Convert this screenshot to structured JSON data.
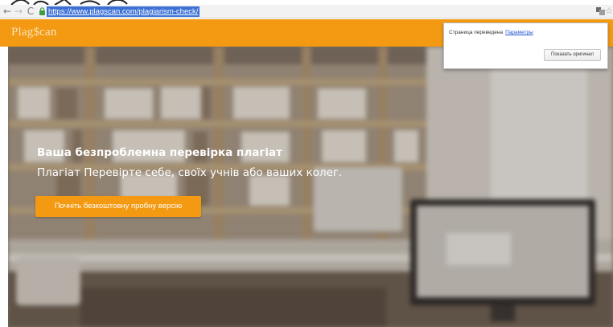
{
  "browser": {
    "url": "https://www.plagscan.com/plagiarism-check/",
    "back_glyph": "←",
    "forward_glyph": "→",
    "reload_glyph": "C",
    "star_glyph": "☆",
    "icons": [
      "back-arrow-icon",
      "forward-arrow-icon",
      "reload-icon",
      "lock-icon",
      "translate-icon",
      "star-icon"
    ]
  },
  "header": {
    "logo_text": "Plag$can",
    "bg_color": "#f39a12"
  },
  "hero": {
    "title": "Ваша безпроблемна перевірка плагіат",
    "subtitle": "Плагіат Перевірте себе, своїх учнів або ваших колег.",
    "cta_label": "Почніть безкоштовну пробну версію",
    "cta_color": "#f39a12"
  },
  "translate_popup": {
    "status_text": "Страница переведена",
    "options_link": "Параметры",
    "show_original_label": "Показать оригинал"
  }
}
